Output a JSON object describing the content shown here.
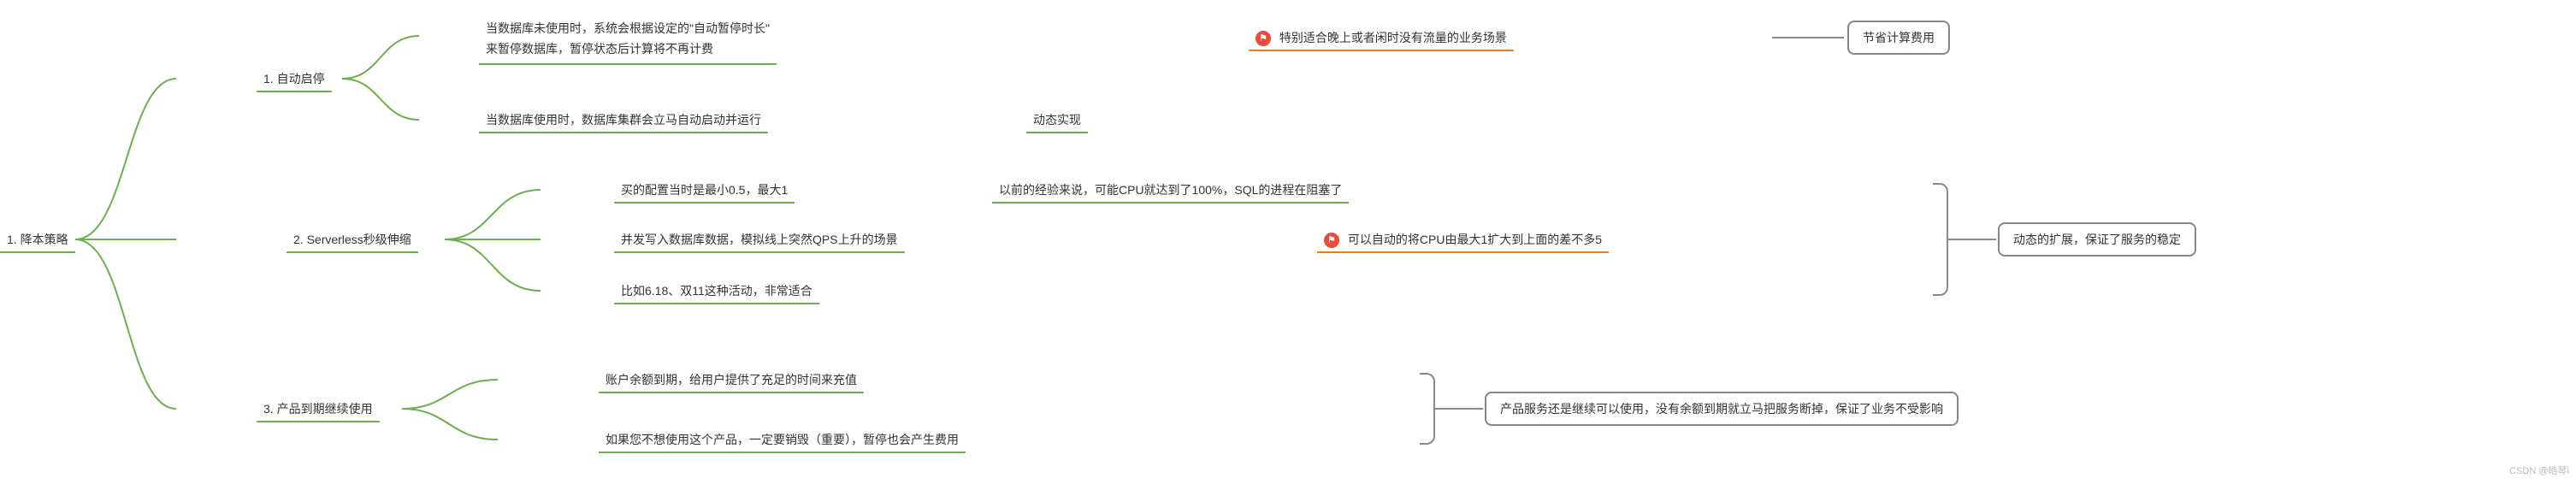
{
  "root": {
    "label": "1. 降本策略"
  },
  "b1": {
    "label": "1. 自动启停",
    "c1": {
      "line1": "当数据库未使用时，系统会根据设定的\"自动暂停时长\"",
      "line2": "来暂停数据库，暂停状态后计算将不再计费",
      "note": "特别适合晚上或者闲时没有流量的业务场景",
      "box": "节省计算费用"
    },
    "c2": {
      "text": "当数据库使用时，数据库集群会立马自动启动并运行",
      "tail": "动态实现"
    }
  },
  "b2": {
    "label": "2. Serverless秒级伸缩",
    "c1": {
      "text": "买的配置当时是最小0.5，最大1",
      "tail": "以前的经验来说，可能CPU就达到了100%，SQL的进程在阻塞了"
    },
    "c2": {
      "text": "并发写入数据库数据，模拟线上突然QPS上升的场景",
      "note": "可以自动的将CPU由最大1扩大到上面的差不多5"
    },
    "c3": {
      "text": "比如6.18、双11这种活动，非常适合"
    },
    "box": "动态的扩展，保证了服务的稳定"
  },
  "b3": {
    "label": "3. 产品到期继续使用",
    "c1": {
      "text": "账户余额到期，给用户提供了充足的时间来充值"
    },
    "c2": {
      "text": "如果您不想使用这个产品，一定要销毁（重要），暂停也会产生费用"
    },
    "box": "产品服务还是继续可以使用，没有余额到期就立马把服务断掉，保证了业务不受影响"
  },
  "watermark": "CSDN @皓琴i"
}
